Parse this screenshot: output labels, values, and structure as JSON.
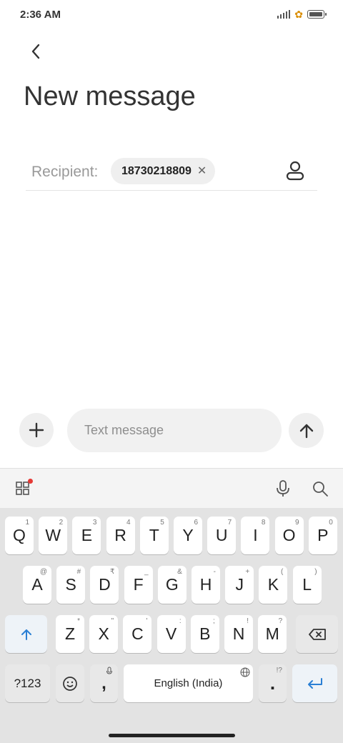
{
  "status_bar": {
    "time": "2:36 AM"
  },
  "header": {
    "title": "New message"
  },
  "recipient": {
    "label": "Recipient:",
    "chip": "18730218809",
    "chip_remove": "✕"
  },
  "compose": {
    "placeholder": "Text message"
  },
  "keyboard": {
    "row1": [
      {
        "label": "Q",
        "hint": "1"
      },
      {
        "label": "W",
        "hint": "2"
      },
      {
        "label": "E",
        "hint": "3"
      },
      {
        "label": "R",
        "hint": "4"
      },
      {
        "label": "T",
        "hint": "5"
      },
      {
        "label": "Y",
        "hint": "6"
      },
      {
        "label": "U",
        "hint": "7"
      },
      {
        "label": "I",
        "hint": "8"
      },
      {
        "label": "O",
        "hint": "9"
      },
      {
        "label": "P",
        "hint": "0"
      }
    ],
    "row2": [
      {
        "label": "A",
        "hint": "@"
      },
      {
        "label": "S",
        "hint": "#"
      },
      {
        "label": "D",
        "hint": "₹"
      },
      {
        "label": "F",
        "hint": "_"
      },
      {
        "label": "G",
        "hint": "&"
      },
      {
        "label": "H",
        "hint": "-"
      },
      {
        "label": "J",
        "hint": "+"
      },
      {
        "label": "K",
        "hint": "("
      },
      {
        "label": "L",
        "hint": ")"
      }
    ],
    "row3": [
      {
        "label": "Z",
        "hint": "*"
      },
      {
        "label": "X",
        "hint": "\""
      },
      {
        "label": "C",
        "hint": "'"
      },
      {
        "label": "V",
        "hint": ":"
      },
      {
        "label": "B",
        "hint": ";"
      },
      {
        "label": "N",
        "hint": "!"
      },
      {
        "label": "M",
        "hint": "?"
      }
    ],
    "symbols_label": "?123",
    "comma_label": ",",
    "space_label": "English (India)",
    "period_label": ".",
    "period_hint": "!?"
  }
}
